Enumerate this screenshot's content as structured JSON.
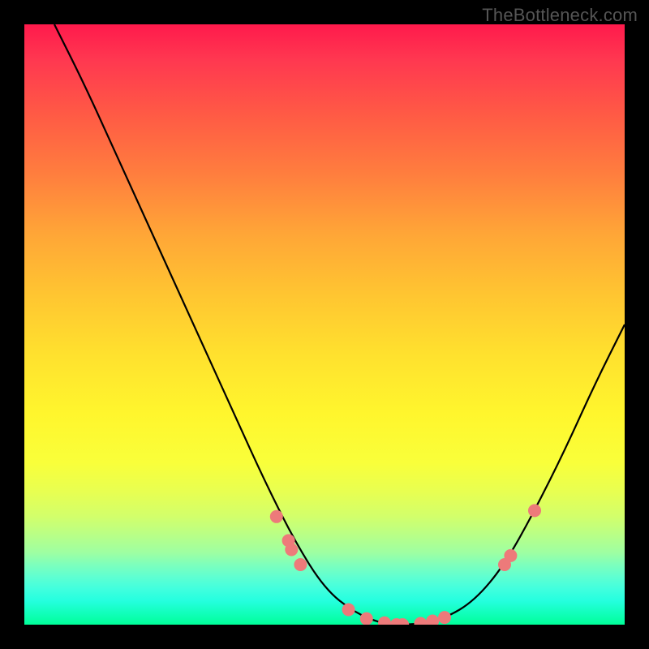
{
  "watermark": "TheBottleneck.com",
  "chart_data": {
    "type": "line",
    "title": "",
    "xlabel": "",
    "ylabel": "",
    "xlim": [
      0,
      100
    ],
    "ylim": [
      0,
      100
    ],
    "curve": {
      "name": "bottleneck-curve",
      "points": [
        {
          "x": 5,
          "y": 100
        },
        {
          "x": 10,
          "y": 90
        },
        {
          "x": 15,
          "y": 79
        },
        {
          "x": 20,
          "y": 68
        },
        {
          "x": 25,
          "y": 57
        },
        {
          "x": 30,
          "y": 46
        },
        {
          "x": 35,
          "y": 35
        },
        {
          "x": 40,
          "y": 24
        },
        {
          "x": 45,
          "y": 14
        },
        {
          "x": 50,
          "y": 6
        },
        {
          "x": 55,
          "y": 2
        },
        {
          "x": 60,
          "y": 0
        },
        {
          "x": 65,
          "y": 0
        },
        {
          "x": 70,
          "y": 1
        },
        {
          "x": 75,
          "y": 4
        },
        {
          "x": 80,
          "y": 10
        },
        {
          "x": 85,
          "y": 19
        },
        {
          "x": 90,
          "y": 29
        },
        {
          "x": 95,
          "y": 40
        },
        {
          "x": 100,
          "y": 50
        }
      ]
    },
    "markers": [
      {
        "x": 42,
        "y": 18
      },
      {
        "x": 44,
        "y": 14
      },
      {
        "x": 44.5,
        "y": 12.5
      },
      {
        "x": 46,
        "y": 10
      },
      {
        "x": 54,
        "y": 2.5
      },
      {
        "x": 57,
        "y": 1
      },
      {
        "x": 60,
        "y": 0.3
      },
      {
        "x": 62,
        "y": 0
      },
      {
        "x": 63,
        "y": 0
      },
      {
        "x": 66,
        "y": 0.2
      },
      {
        "x": 68,
        "y": 0.6
      },
      {
        "x": 70,
        "y": 1.2
      },
      {
        "x": 80,
        "y": 10
      },
      {
        "x": 81,
        "y": 11.5
      },
      {
        "x": 85,
        "y": 19
      }
    ],
    "marker_color": "#ed7a7a",
    "curve_color": "#000000"
  }
}
